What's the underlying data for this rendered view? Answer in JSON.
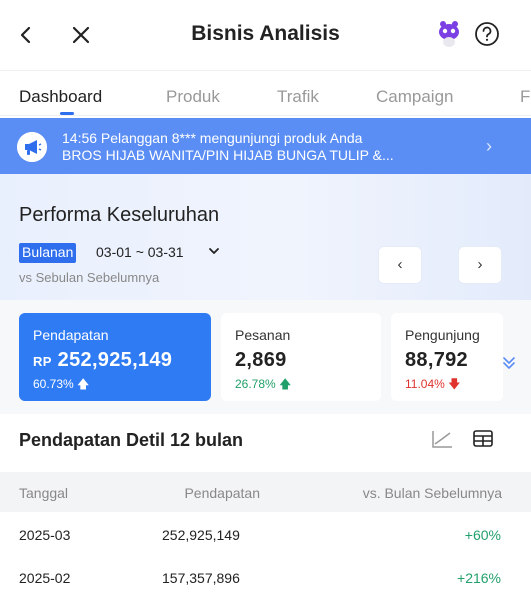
{
  "header": {
    "title": "Bisnis Analisis",
    "icons": [
      "back-icon",
      "close-icon",
      "mascot-icon",
      "help-icon"
    ]
  },
  "tabs": [
    {
      "label": "Dashboard",
      "active": true
    },
    {
      "label": "Produk",
      "active": false
    },
    {
      "label": "Trafik",
      "active": false
    },
    {
      "label": "Campaign",
      "active": false
    },
    {
      "label": "F",
      "active": false
    }
  ],
  "banner": {
    "line1": "14:56 Pelanggan 8*** mengunjungi produk Anda",
    "line2": "BROS HIJAB WANITA/PIN HIJAB BUNGA TULIP &..."
  },
  "performance": {
    "title": "Performa Keseluruhan",
    "period_type": "Bulanan",
    "period_range": "03-01 ~ 03-31",
    "comparison": "vs Sebulan Sebelumnya"
  },
  "metrics": [
    {
      "label": "Pendapatan",
      "currency": "RP",
      "value": "252,925,149",
      "change": "60.73%",
      "trend": "up"
    },
    {
      "label": "Pesanan",
      "currency": "",
      "value": "2,869",
      "change": "26.78%",
      "trend": "up"
    },
    {
      "label": "Pengunjung",
      "currency": "",
      "value": "88,792",
      "change": "11.04%",
      "trend": "down"
    }
  ],
  "detail": {
    "title": "Pendapatan Detil 12 bulan",
    "columns": [
      "Tanggal",
      "Pendapatan",
      "vs. Bulan Sebelumnya"
    ],
    "rows": [
      {
        "date": "2025-03",
        "revenue": "252,925,149",
        "change": "+60%"
      },
      {
        "date": "2025-02",
        "revenue": "157,357,896",
        "change": "+216%"
      }
    ]
  },
  "colors": {
    "accent": "#2f7bf3",
    "banner": "#5b8ef5",
    "positive": "#22a06b",
    "negative": "#e0332e"
  }
}
